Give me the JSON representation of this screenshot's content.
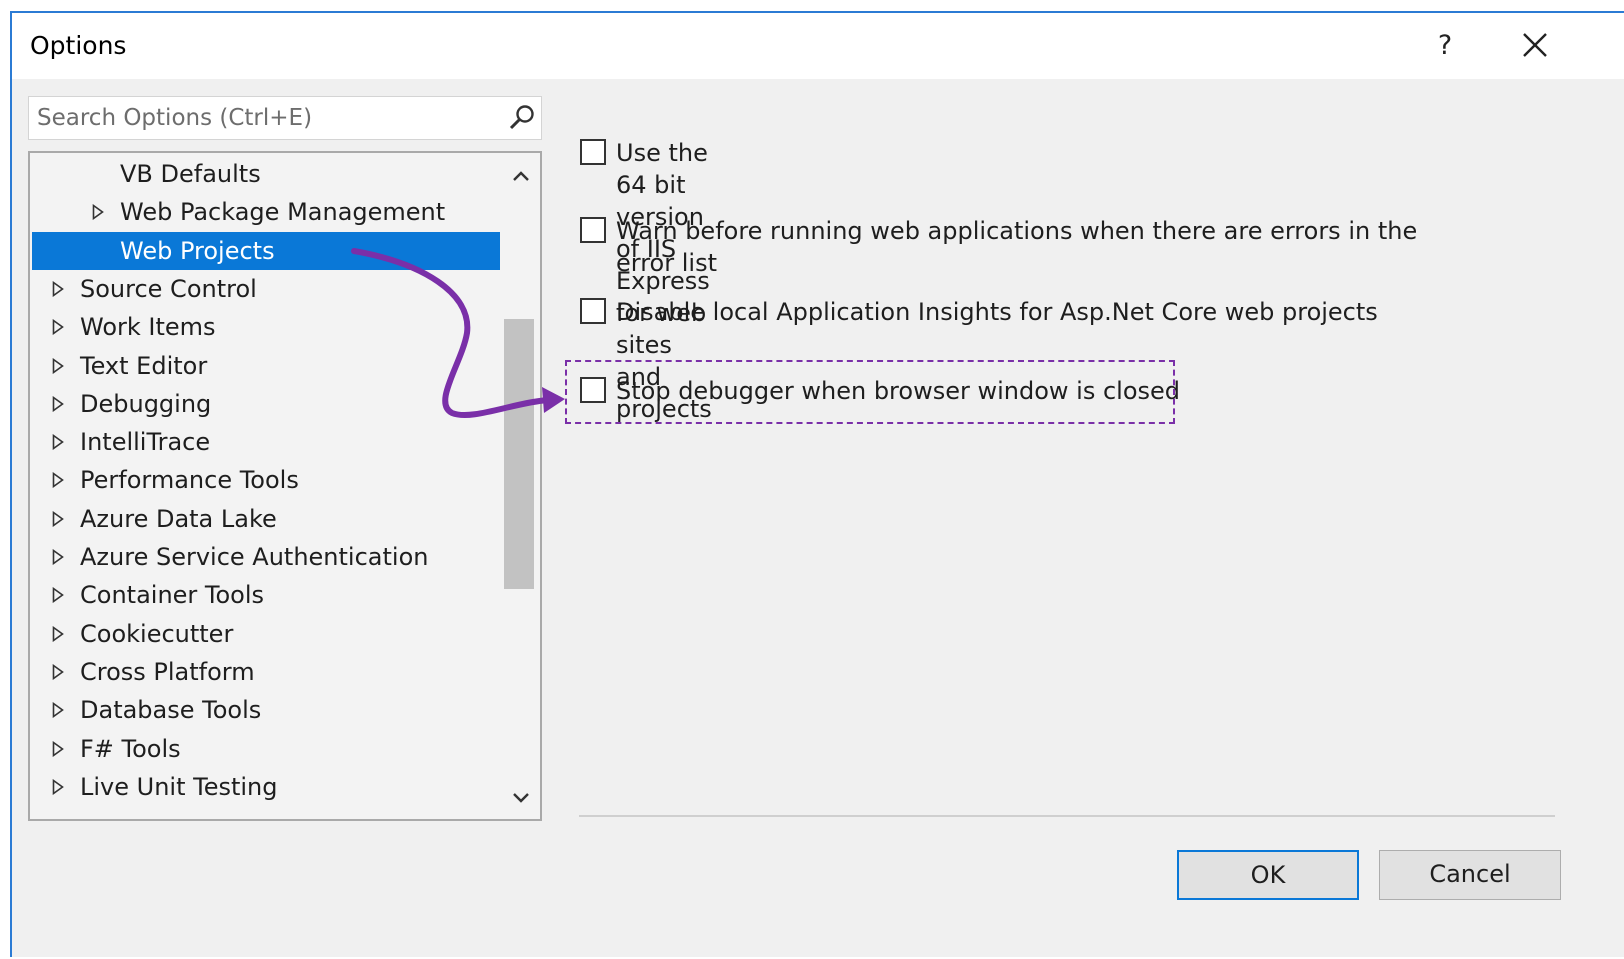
{
  "window": {
    "title": "Options",
    "help_label": "?"
  },
  "search": {
    "placeholder": "Search Options (Ctrl+E)"
  },
  "tree": {
    "items": [
      {
        "label": "VB Defaults",
        "level": 2,
        "expandable": false,
        "selected": false
      },
      {
        "label": "Web Package Management",
        "level": 1,
        "expandable": true,
        "selected": false
      },
      {
        "label": "Web Projects",
        "level": 2,
        "expandable": false,
        "selected": true
      },
      {
        "label": "Source Control",
        "level": 0,
        "expandable": true,
        "selected": false
      },
      {
        "label": "Work Items",
        "level": 0,
        "expandable": true,
        "selected": false
      },
      {
        "label": "Text Editor",
        "level": 0,
        "expandable": true,
        "selected": false
      },
      {
        "label": "Debugging",
        "level": 0,
        "expandable": true,
        "selected": false
      },
      {
        "label": "IntelliTrace",
        "level": 0,
        "expandable": true,
        "selected": false
      },
      {
        "label": "Performance Tools",
        "level": 0,
        "expandable": true,
        "selected": false
      },
      {
        "label": "Azure Data Lake",
        "level": 0,
        "expandable": true,
        "selected": false
      },
      {
        "label": "Azure Service Authentication",
        "level": 0,
        "expandable": true,
        "selected": false
      },
      {
        "label": "Container Tools",
        "level": 0,
        "expandable": true,
        "selected": false
      },
      {
        "label": "Cookiecutter",
        "level": 0,
        "expandable": true,
        "selected": false
      },
      {
        "label": "Cross Platform",
        "level": 0,
        "expandable": true,
        "selected": false
      },
      {
        "label": "Database Tools",
        "level": 0,
        "expandable": true,
        "selected": false
      },
      {
        "label": "F# Tools",
        "level": 0,
        "expandable": true,
        "selected": false
      },
      {
        "label": "Live Unit Testing",
        "level": 0,
        "expandable": true,
        "selected": false
      }
    ]
  },
  "options": [
    {
      "label": "Use the 64 bit version of IIS Express for web sites and projects",
      "checked": false
    },
    {
      "label": "Warn before running web applications when there are errors in the error list",
      "checked": false
    },
    {
      "label": "Disable local Application Insights for Asp.Net Core web projects",
      "checked": false
    },
    {
      "label": "Stop debugger when browser window is closed",
      "checked": false
    }
  ],
  "buttons": {
    "ok": "OK",
    "cancel": "Cancel"
  },
  "colors": {
    "selection": "#0a78d7",
    "annotation": "#7a2fa8"
  }
}
